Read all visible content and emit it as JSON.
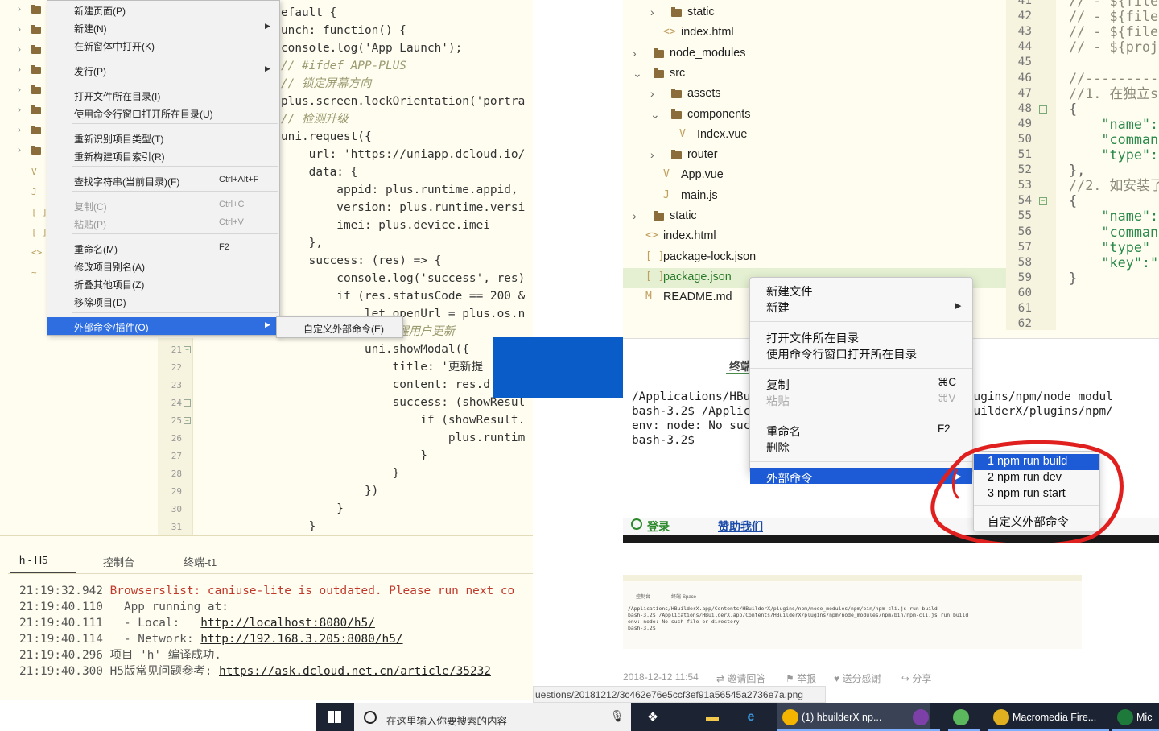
{
  "left_ide": {
    "context_menu": {
      "items": [
        {
          "label": "新建页面(P)",
          "shortcut": "",
          "submenu": false,
          "disabled": false
        },
        {
          "label": "新建(N)",
          "shortcut": "",
          "submenu": true,
          "disabled": false
        },
        {
          "label": "在新窗体中打开(K)",
          "shortcut": "",
          "submenu": false,
          "disabled": false
        },
        {
          "label": "发行(P)",
          "shortcut": "",
          "submenu": true,
          "disabled": false
        },
        {
          "label": "打开文件所在目录(I)",
          "shortcut": "",
          "submenu": false,
          "disabled": false
        },
        {
          "label": "使用命令行窗口打开所在目录(U)",
          "shortcut": "",
          "submenu": false,
          "disabled": false
        },
        {
          "label": "重新识别项目类型(T)",
          "shortcut": "",
          "submenu": false,
          "disabled": false
        },
        {
          "label": "重新构建项目索引(R)",
          "shortcut": "",
          "submenu": false,
          "disabled": false
        },
        {
          "label": "查找字符串(当前目录)(F)",
          "shortcut": "Ctrl+Alt+F",
          "submenu": false,
          "disabled": false
        },
        {
          "label": "复制(C)",
          "shortcut": "Ctrl+C",
          "submenu": false,
          "disabled": true
        },
        {
          "label": "粘贴(P)",
          "shortcut": "Ctrl+V",
          "submenu": false,
          "disabled": true
        },
        {
          "label": "重命名(M)",
          "shortcut": "F2",
          "submenu": false,
          "disabled": false
        },
        {
          "label": "修改项目别名(A)",
          "shortcut": "",
          "submenu": false,
          "disabled": false
        },
        {
          "label": "折叠其他项目(Z)",
          "shortcut": "",
          "submenu": false,
          "disabled": false
        },
        {
          "label": "移除项目(D)",
          "shortcut": "",
          "submenu": false,
          "disabled": false
        },
        {
          "label": "外部命令/插件(O)",
          "shortcut": "",
          "submenu": true,
          "disabled": false,
          "highlighted": true
        }
      ],
      "submenu_item": "自定义外部命令(E)"
    },
    "code_lines": [
      "efault {",
      "unch: function() {",
      "console.log('App Launch');",
      "// #ifdef APP-PLUS",
      "// 锁定屏幕方向",
      "plus.screen.lockOrientation('portra",
      "// 检测升级",
      "uni.request({",
      "    url: 'https://uniapp.dcloud.io/",
      "    data: {",
      "        appid: plus.runtime.appid,",
      "        version: plus.runtime.versi",
      "        imei: plus.device.imei",
      "    },",
      "    success: (res) => {",
      "        console.log('success', res)",
      "        if (res.statusCode == 200 &",
      "            let openUrl = plus.os.n",
      "            // 提醒用户更新",
      "            uni.showModal({",
      "                title: '更新提",
      "                content: res.d",
      "                success: (showResul",
      "                    if (showResult.",
      "                        plus.runtim",
      "                    }",
      "                }",
      "            })",
      "        }",
      "    }"
    ],
    "gutter_numbers": [
      "21",
      "22",
      "23",
      "24",
      "25",
      "26",
      "27",
      "28",
      "29",
      "30",
      "31"
    ],
    "console": {
      "tabs": [
        "h - H5",
        "控制台",
        "终端-t1"
      ],
      "lines": [
        {
          "time": "21:19:32.942",
          "text": "Browserslist: caniuse-lite is outdated. Please run next co"
        },
        {
          "time": "21:19:40.110",
          "text": "  App running at:"
        },
        {
          "time": "21:19:40.111",
          "text": "  - Local:   ",
          "link": "http://localhost:8080/h5/"
        },
        {
          "time": "21:19:40.114",
          "text": "  - Network: ",
          "link": "http://192.168.3.205:8080/h5/"
        },
        {
          "time": "21:19:40.296",
          "text": "项目 'h' 编译成功."
        },
        {
          "time": "21:19:40.300",
          "text": "H5版常见问题参考: ",
          "link": "https://ask.dcloud.net.cn/article/35232"
        }
      ]
    }
  },
  "right_ide": {
    "tree": [
      {
        "label": "static",
        "type": "folder",
        "indent": 3,
        "expanded": false
      },
      {
        "label": "index.html",
        "type": "html",
        "indent": 3
      },
      {
        "label": "node_modules",
        "type": "folder",
        "indent": 2,
        "expanded": false
      },
      {
        "label": "src",
        "type": "folder",
        "indent": 2,
        "expanded": true
      },
      {
        "label": "assets",
        "type": "folder",
        "indent": 3,
        "expanded": false
      },
      {
        "label": "components",
        "type": "folder",
        "indent": 3,
        "expanded": true
      },
      {
        "label": "Index.vue",
        "type": "vue",
        "indent": 4
      },
      {
        "label": "router",
        "type": "folder",
        "indent": 3,
        "expanded": false
      },
      {
        "label": "App.vue",
        "type": "vue",
        "indent": 3
      },
      {
        "label": "main.js",
        "type": "js",
        "indent": 3
      },
      {
        "label": "static",
        "type": "folder",
        "indent": 2,
        "expanded": false
      },
      {
        "label": "index.html",
        "type": "html",
        "indent": 2
      },
      {
        "label": "package-lock.json",
        "type": "json",
        "indent": 2
      },
      {
        "label": "package.json",
        "type": "json",
        "indent": 2,
        "selected": true
      },
      {
        "label": "README.md",
        "type": "md",
        "indent": 2
      }
    ],
    "line_numbers": [
      "41",
      "42",
      "43",
      "44",
      "45",
      "46",
      "47",
      "48",
      "49",
      "50",
      "51",
      "52",
      "53",
      "54",
      "55",
      "56",
      "57",
      "58",
      "59",
      "60",
      "61",
      "62"
    ],
    "code_lines": [
      "// - ${file",
      "// - ${file",
      "// - ${file",
      "// - ${proj",
      "",
      "//---------",
      "//1. 在独立s",
      "{",
      "    \"name\":",
      "    \"comman",
      "    \"type\":",
      "},",
      "//2. 如安装了",
      "{",
      "    \"name\":",
      "    \"comman",
      "    \"type\"",
      "    \"key\":\"",
      "}",
      "",
      "",
      ""
    ],
    "context_menu": {
      "groups": [
        [
          {
            "label": "新建文件",
            "shortcut": ""
          },
          {
            "label": "新建",
            "shortcut": "",
            "submenu": true
          }
        ],
        [
          {
            "label": "打开文件所在目录",
            "shortcut": ""
          },
          {
            "label": "使用命令行窗口打开所在目录",
            "shortcut": ""
          }
        ],
        [
          {
            "label": "复制",
            "shortcut": "⌘C"
          },
          {
            "label": "粘贴",
            "shortcut": "⌘V",
            "disabled": true
          }
        ],
        [
          {
            "label": "重命名",
            "shortcut": "F2"
          },
          {
            "label": "删除",
            "shortcut": ""
          }
        ],
        [
          {
            "label": "外部命令",
            "shortcut": "",
            "submenu": true,
            "highlighted": true
          }
        ]
      ]
    },
    "submenu": [
      "1 npm run build",
      "2 npm run dev",
      "3 npm run start",
      "自定义外部命令"
    ],
    "terminal_tab": "终端",
    "terminal_lines": [
      "/Applications/HBuilderX.app/Contents/HBuilderX/plugins/npm/node_modul",
      "bash-3.2$ /Applications/HBuilderX.app/Contents/HBuilderX/plugins/npm/",
      "env: node: No such file or directory",
      "bash-3.2$"
    ],
    "login_label": "登录",
    "sponsor_label": "赞助我们"
  },
  "small_screenshot": {
    "tabs": [
      "控制台",
      "终端-Space"
    ],
    "lines": [
      "/Applications/HBuilderX.app/Contents/HBuilderX/plugins/npm/node_modules/npm/bin/npm-cli.js run build",
      "bash-3.2$ /Applications/HBuilderX.app/Contents/HBuilderX/plugins/npm/node_modules/npm/bin/npm-cli.js run build",
      "env: node: No such file or directory",
      "bash-3.2$"
    ]
  },
  "meta": {
    "date": "2018-12-12 11:54",
    "invite": "邀请回答",
    "report": "举报",
    "thanks": "送分感谢",
    "share": "分享"
  },
  "url_text": "uestions/20181212/3c462e76e5ccf3ef91a56545a2736e7a.png",
  "taskbar": {
    "search_placeholder": "在这里输入你要搜索的内容",
    "apps": [
      {
        "label": "(1) hbuilderX np...",
        "color": "#f4b400"
      },
      {
        "label": "",
        "color": "#7d3fa8"
      },
      {
        "label": "",
        "color": "#5cb85c"
      },
      {
        "label": "Macromedia Fire...",
        "color": "#e0b020"
      },
      {
        "label": "Mic",
        "color": "#1e7a3a"
      }
    ]
  },
  "colors": {
    "menu_highlight": "#2e6ee0",
    "arrow_blue": "#0a5cc8",
    "annotation_red": "#e0201f",
    "ide_bg": "#fffdf0"
  }
}
